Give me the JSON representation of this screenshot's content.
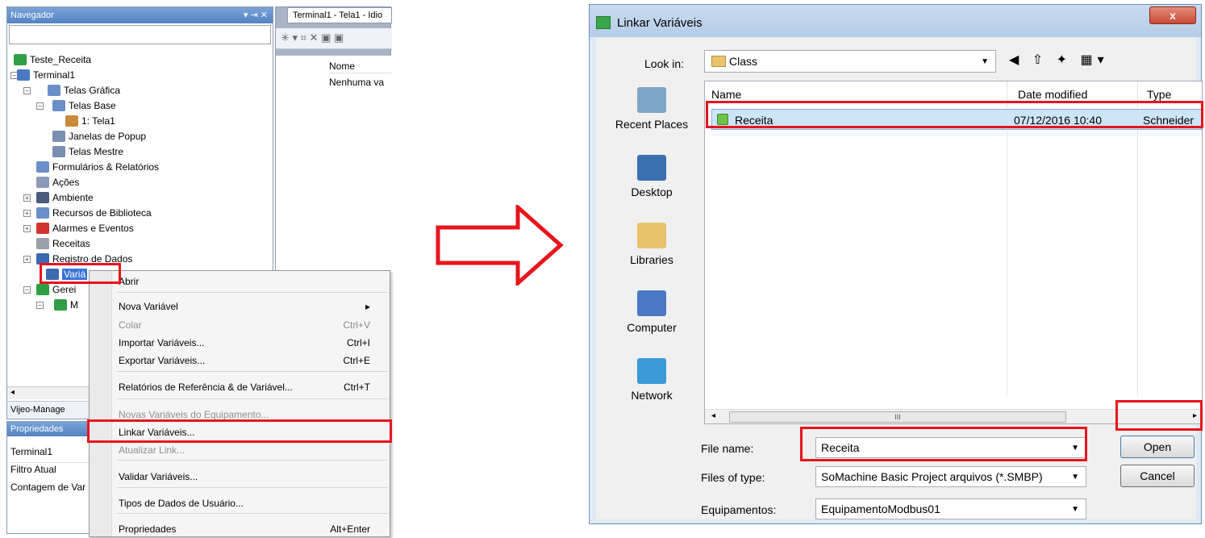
{
  "navigator": {
    "title": "Navegador",
    "pin": "▾ ⇥ ✕",
    "tree": [
      {
        "label": "Teste_Receita",
        "color": "#2f9e44"
      },
      {
        "label": "Terminal1",
        "color": "#4a78c2"
      },
      {
        "label": "Telas Gráfica",
        "color": "#6b8fc8"
      },
      {
        "label": "Telas Base",
        "color": "#6b8fc8"
      },
      {
        "label": "1: Tela1",
        "color": "#c98a3a"
      },
      {
        "label": "Janelas de Popup",
        "color": "#7a8fb0"
      },
      {
        "label": "Telas Mestre",
        "color": "#7a8fb0"
      },
      {
        "label": "Formulários & Relatórios",
        "color": "#6b8fc8"
      },
      {
        "label": "Ações",
        "color": "#8a9ab8"
      },
      {
        "label": "Ambiente",
        "color": "#4a5a7a"
      },
      {
        "label": "Recursos de Biblioteca",
        "color": "#6b8fc8"
      },
      {
        "label": "Alarmes e Eventos",
        "color": "#d0342c"
      },
      {
        "label": "Receitas",
        "color": "#9aa0a8"
      },
      {
        "label": "Registro de Dados",
        "color": "#3a6ab0"
      },
      {
        "label": "Variá",
        "color": "#3a6ab0"
      },
      {
        "label": "Gerei",
        "color": "#2f9e44"
      },
      {
        "label": "M",
        "color": "#2f9e44"
      }
    ],
    "bottom_tab": "Vijeo-Manage"
  },
  "properties": {
    "title": "Propriedades",
    "object": "Terminal1",
    "rows": [
      "Filtro Atual",
      "Contagem de Var"
    ]
  },
  "editor": {
    "tab": "Terminal1 - Tela1 - Idio",
    "toolbar": "✳ ▾ ⌗ ✕ ▣ ▣",
    "column": "Nome",
    "empty": "Nenhuma va"
  },
  "context_menu": {
    "items": [
      {
        "label": "Abrir",
        "shortcut": "",
        "disabled": false
      },
      {
        "label": "Nova Variável",
        "shortcut": "▸",
        "disabled": false
      },
      {
        "label": "Colar",
        "shortcut": "Ctrl+V",
        "disabled": true
      },
      {
        "label": "Importar Variáveis...",
        "shortcut": "Ctrl+I",
        "disabled": false
      },
      {
        "label": "Exportar Variáveis...",
        "shortcut": "Ctrl+E",
        "disabled": false
      },
      {
        "label": "Relatórios de Referência & de Variável...",
        "shortcut": "Ctrl+T",
        "disabled": false
      },
      {
        "label": "Novas Variáveis do Equipamento...",
        "shortcut": "",
        "disabled": true
      },
      {
        "label": "Linkar Variáveis...",
        "shortcut": "",
        "disabled": false
      },
      {
        "label": "Atualizar Link...",
        "shortcut": "",
        "disabled": true
      },
      {
        "label": "Validar Variáveis...",
        "shortcut": "",
        "disabled": false
      },
      {
        "label": "Tipos de Dados de Usuário...",
        "shortcut": "",
        "disabled": false
      },
      {
        "label": "Propriedades",
        "shortcut": "Alt+Enter",
        "disabled": false
      }
    ]
  },
  "dialog": {
    "title": "Linkar Variáveis",
    "close": "x",
    "look_in_label": "Look in:",
    "look_in_value": "Class",
    "nav_icons": "◀ ⇧ ✦ ▦▾",
    "places": [
      "Recent Places",
      "Desktop",
      "Libraries",
      "Computer",
      "Network"
    ],
    "columns": [
      "Name",
      "Date modified",
      "Type"
    ],
    "files": [
      {
        "name": "Receita",
        "date": "07/12/2016 10:40",
        "type": "Schneider"
      }
    ],
    "scroll_grip": "III",
    "file_name_label": "File name:",
    "file_name_value": "Receita",
    "file_type_label": "Files of type:",
    "file_type_value": "SoMachine Basic Project arquivos (*.SMBP)",
    "equip_label": "Equipamentos:",
    "equip_value": "EquipamentoModbus01",
    "open_label": "Open",
    "cancel_label": "Cancel"
  },
  "colors": {
    "highlight": "#e8141c",
    "accent": "#5483c2"
  }
}
